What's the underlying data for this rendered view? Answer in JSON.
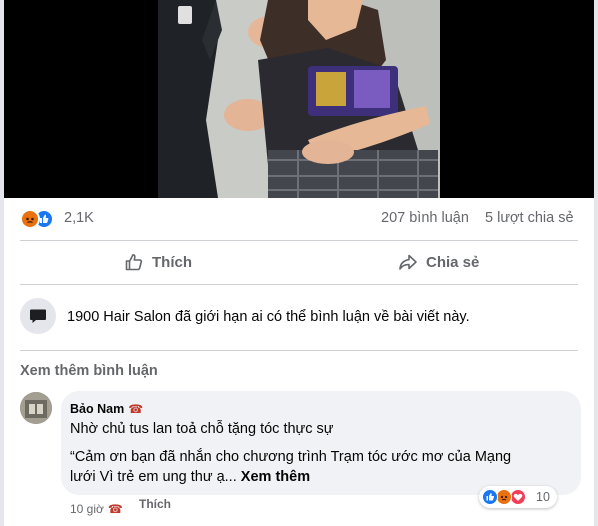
{
  "post": {
    "reaction_count": "2,1K",
    "comment_count": "207 bình luận",
    "share_count": "5 lượt chia sẻ"
  },
  "actions": {
    "like_label": "Thích",
    "share_label": "Chia sẻ"
  },
  "notice": {
    "text": "1900 Hair Salon đã giới hạn ai có thể bình luận về bài viết này."
  },
  "comments_section": {
    "view_more_label": "Xem thêm bình luận"
  },
  "comment": {
    "author": "Bảo Nam",
    "author_emoji": "☎",
    "line1": "Nhờ chủ tus lan toả chỗ tặng tóc thực sự",
    "line2": "“Cảm ơn bạn đã nhắn cho chương trình Trạm tóc ước mơ của Mạng",
    "line3": "lưới Vì trẻ em ung thư ạ...",
    "see_more_label": "Xem thêm",
    "reaction_count": "10",
    "time": "10 giờ",
    "time_emoji": "☎",
    "like_label": "Thích"
  },
  "colors": {
    "like_blue": "#1877f2",
    "love_red": "#f33e58",
    "angry_orange": "#e9710f",
    "secondary_text": "#65676b",
    "divider": "#ced0d4"
  },
  "icons": {
    "reactions": [
      "angry-react-icon",
      "like-react-icon"
    ],
    "comment_reactions": [
      "like-react-icon",
      "angry-react-icon",
      "love-react-icon"
    ],
    "like_button": "thumbs-up-outline-icon",
    "share_button": "share-arrow-icon",
    "notice": "speech-bubble-icon"
  }
}
